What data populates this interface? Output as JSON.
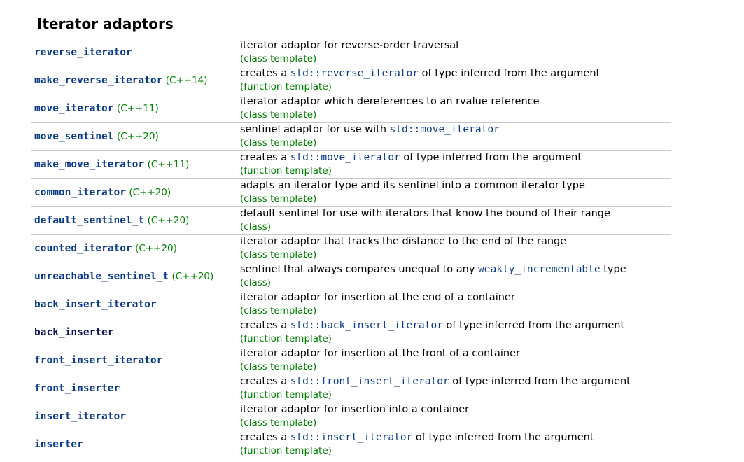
{
  "heading": "Iterator adaptors",
  "rows": [
    {
      "name": "reverse_iterator",
      "version": "",
      "desc_pre": "iterator adaptor for reverse-order traversal",
      "desc_code": "",
      "desc_post": "",
      "kind": "(class template)"
    },
    {
      "name": "make_reverse_iterator",
      "version": "(C++14)",
      "desc_pre": "creates a ",
      "desc_code": "std::reverse_iterator",
      "desc_post": " of type inferred from the argument",
      "kind": "(function template)"
    },
    {
      "name": "move_iterator",
      "version": "(C++11)",
      "desc_pre": "iterator adaptor which dereferences to an rvalue reference",
      "desc_code": "",
      "desc_post": "",
      "kind": "(class template)"
    },
    {
      "name": "move_sentinel",
      "version": "(C++20)",
      "desc_pre": "sentinel adaptor for use with ",
      "desc_code": "std::move_iterator",
      "desc_post": "",
      "kind": "(class template)"
    },
    {
      "name": "make_move_iterator",
      "version": "(C++11)",
      "desc_pre": "creates a ",
      "desc_code": "std::move_iterator",
      "desc_post": " of type inferred from the argument",
      "kind": "(function template)"
    },
    {
      "name": "common_iterator",
      "version": "(C++20)",
      "desc_pre": "adapts an iterator type and its sentinel into a common iterator type",
      "desc_code": "",
      "desc_post": "",
      "kind": "(class template)"
    },
    {
      "name": "default_sentinel_t",
      "version": "(C++20)",
      "desc_pre": "default sentinel for use with iterators that know the bound of their range",
      "desc_code": "",
      "desc_post": "",
      "kind": "(class)"
    },
    {
      "name": "counted_iterator",
      "version": "(C++20)",
      "desc_pre": "iterator adaptor that tracks the distance to the end of the range",
      "desc_code": "",
      "desc_post": "",
      "kind": "(class template)"
    },
    {
      "name": "unreachable_sentinel_t",
      "version": "(C++20)",
      "desc_pre": "sentinel that always compares unequal to any ",
      "desc_code": "weakly_incrementable",
      "desc_post": " type",
      "kind": "(class)"
    },
    {
      "name": "back_insert_iterator",
      "version": "",
      "desc_pre": "iterator adaptor for insertion at the end of a container",
      "desc_code": "",
      "desc_post": "",
      "kind": "(class template)"
    },
    {
      "name": "back_inserter",
      "version": "",
      "desc_pre": "creates a ",
      "desc_code": "std::back_insert_iterator",
      "desc_post": " of type inferred from the argument",
      "kind": "(function template)"
    },
    {
      "name": "front_insert_iterator",
      "version": "",
      "desc_pre": "iterator adaptor for insertion at the front of a container",
      "desc_code": "",
      "desc_post": "",
      "kind": "(class template)"
    },
    {
      "name": "front_inserter",
      "version": "",
      "desc_pre": "creates a ",
      "desc_code": "std::front_insert_iterator",
      "desc_post": " of type inferred from the argument",
      "kind": "(function template)"
    },
    {
      "name": "insert_iterator",
      "version": "",
      "desc_pre": "iterator adaptor for insertion into a container",
      "desc_code": "",
      "desc_post": "",
      "kind": "(class template)"
    },
    {
      "name": "inserter",
      "version": "",
      "desc_pre": "creates a ",
      "desc_code": "std::insert_iterator",
      "desc_post": " of type inferred from the argument",
      "kind": "(function template)"
    }
  ],
  "colors": {
    "link": "#0b3c8c",
    "visited_link": "#11115d",
    "version": "#008000",
    "kind": "#008000",
    "divider": "#c8c8c8"
  }
}
